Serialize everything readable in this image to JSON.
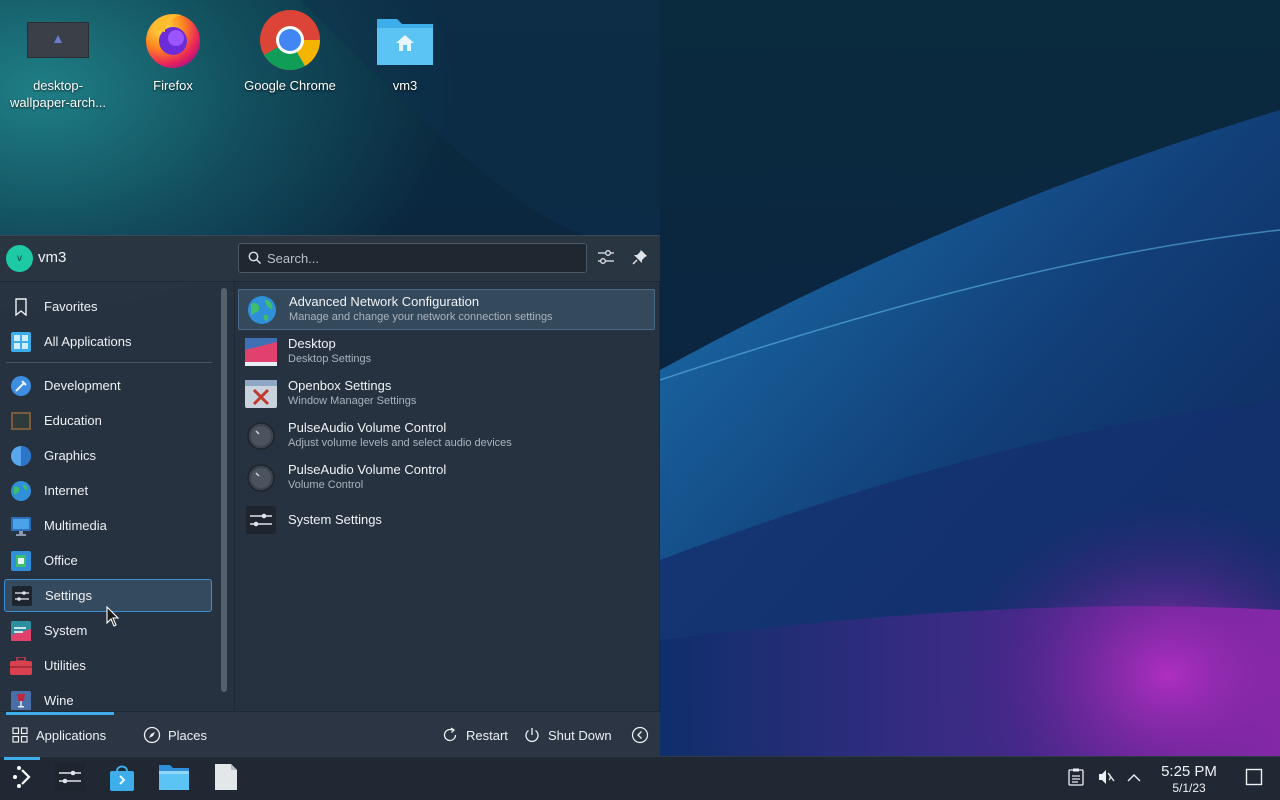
{
  "desktop": {
    "icons": [
      {
        "label": "desktop-wallpaper-arch...",
        "icon": "image-file-icon"
      },
      {
        "label": "Firefox",
        "icon": "firefox-icon"
      },
      {
        "label": "Google Chrome",
        "icon": "chrome-icon"
      },
      {
        "label": "vm3",
        "icon": "home-folder-icon"
      }
    ]
  },
  "launcher": {
    "user": {
      "name": "vm3",
      "avatar_letter": "v"
    },
    "search": {
      "placeholder": "Search..."
    },
    "categories": [
      {
        "label": "Favorites",
        "icon": "bookmark-icon"
      },
      {
        "label": "All Applications",
        "icon": "grid-icon"
      },
      {
        "label": "Development",
        "icon": "development-icon"
      },
      {
        "label": "Education",
        "icon": "education-icon"
      },
      {
        "label": "Graphics",
        "icon": "graphics-icon"
      },
      {
        "label": "Internet",
        "icon": "globe-icon"
      },
      {
        "label": "Multimedia",
        "icon": "multimedia-icon"
      },
      {
        "label": "Office",
        "icon": "office-icon"
      },
      {
        "label": "Settings",
        "icon": "settings-sliders-icon",
        "selected": true
      },
      {
        "label": "System",
        "icon": "system-icon"
      },
      {
        "label": "Utilities",
        "icon": "toolbox-icon"
      },
      {
        "label": "Wine",
        "icon": "wine-icon"
      }
    ],
    "apps": [
      {
        "name": "Advanced Network Configuration",
        "desc": "Manage and change your network connection settings",
        "icon": "network-globe-icon",
        "selected": true
      },
      {
        "name": "Desktop",
        "desc": "Desktop Settings",
        "icon": "desktop-settings-icon"
      },
      {
        "name": "Openbox Settings",
        "desc": "Window Manager Settings",
        "icon": "openbox-icon"
      },
      {
        "name": "PulseAudio Volume Control",
        "desc": "Adjust volume levels and select audio devices",
        "icon": "volume-knob-icon"
      },
      {
        "name": "PulseAudio Volume Control",
        "desc": "Volume Control",
        "icon": "volume-knob-icon"
      },
      {
        "name": "System Settings",
        "desc": "",
        "icon": "system-settings-icon"
      }
    ],
    "footer": {
      "applications_label": "Applications",
      "places_label": "Places",
      "restart_label": "Restart",
      "shutdown_label": "Shut Down"
    }
  },
  "taskbar": {
    "clock": {
      "time": "5:25 PM",
      "date": "5/1/23"
    }
  },
  "colors": {
    "accent": "#3daee9",
    "panel": "#283340",
    "taskbar": "#202833"
  }
}
